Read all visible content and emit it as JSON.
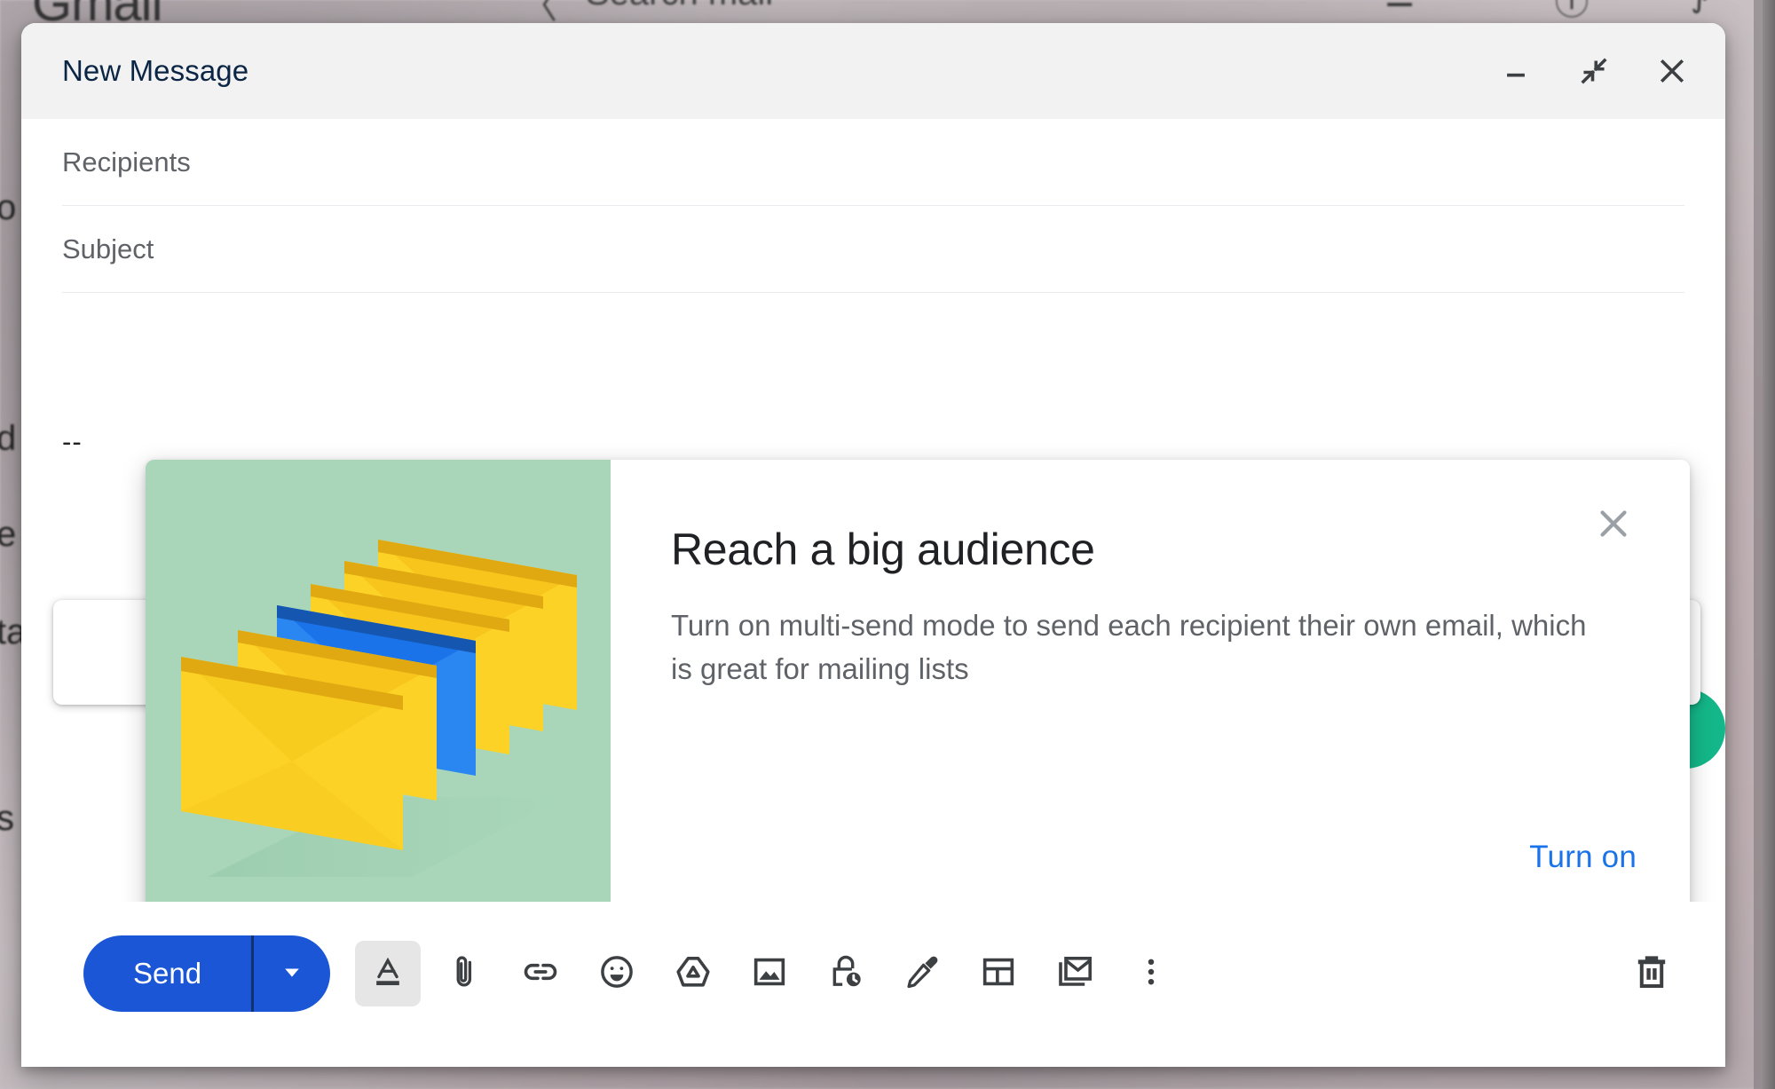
{
  "background": {
    "app_name": "Gmail",
    "search_placeholder": "Search mail",
    "search_icon": "search-icon",
    "tune_icon": "tune-icon",
    "help_icon": "help-icon",
    "settings_icon": "settings-icon",
    "sidebar_fragments": [
      "o",
      "d",
      "e",
      "ta",
      "s"
    ]
  },
  "compose": {
    "title": "New Message",
    "header_buttons": [
      {
        "name": "minimize",
        "icon": "minimize-icon"
      },
      {
        "name": "exit-full-screen",
        "icon": "exit-full-screen-icon"
      },
      {
        "name": "close",
        "icon": "close-icon"
      }
    ],
    "fields": {
      "recipients_label": "Recipients",
      "recipients_value": "",
      "subject_label": "Subject",
      "subject_value": ""
    },
    "body": {
      "signature_separator": "--"
    },
    "toolbar": {
      "send_label": "Send",
      "send_dropdown_icon": "chevron-down-icon",
      "send_color": "#1a56d6",
      "items": [
        {
          "name": "formatting-options",
          "icon": "format-text-icon",
          "active": true
        },
        {
          "name": "attach-files",
          "icon": "paperclip-icon",
          "active": false
        },
        {
          "name": "insert-link",
          "icon": "link-icon",
          "active": false
        },
        {
          "name": "insert-emoji",
          "icon": "emoji-icon",
          "active": false
        },
        {
          "name": "insert-drive-file",
          "icon": "google-drive-icon",
          "active": false
        },
        {
          "name": "insert-photo",
          "icon": "image-icon",
          "active": false
        },
        {
          "name": "confidential-mode",
          "icon": "lock-clock-icon",
          "active": false
        },
        {
          "name": "insert-signature",
          "icon": "pen-icon",
          "active": false
        },
        {
          "name": "layouts",
          "icon": "layout-icon",
          "active": false
        },
        {
          "name": "multi-send-mode",
          "icon": "mail-stack-icon",
          "active": false
        },
        {
          "name": "more-options",
          "icon": "more-vertical-icon",
          "active": false
        }
      ],
      "discard_draft": {
        "name": "discard-draft",
        "icon": "trash-icon"
      }
    },
    "hidden_popups": {
      "left_icon": "undo-arrow-icon",
      "right_icon": "chevron-down-icon",
      "fab_color": "#14b789"
    }
  },
  "promo_card": {
    "title": "Reach a big audience",
    "body": "Turn on multi-send mode to send each recipient their own email, which is great for mailing lists",
    "action_label": "Turn on",
    "action_color": "#1a73e8",
    "close_icon": "close-icon",
    "illustration": {
      "name": "envelopes-illustration",
      "background_color": "#a9d6b9",
      "envelope_yellow": "#fcd227",
      "envelope_yellow_dark": "#e0a911",
      "envelope_blue": "#1a73e8",
      "envelope_blue_dark": "#1557b0",
      "envelope_count": 6,
      "highlight_index": 3
    }
  }
}
